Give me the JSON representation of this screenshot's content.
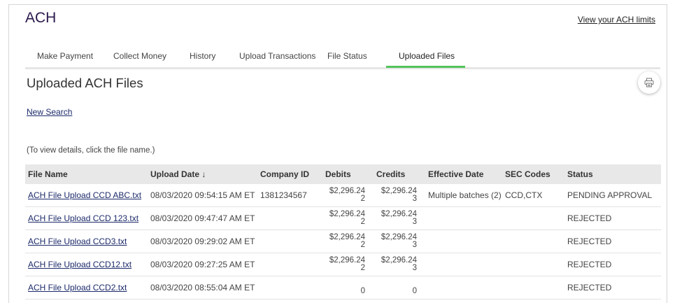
{
  "header": {
    "title": "ACH",
    "limits_link": "View your ACH limits"
  },
  "tabs": [
    {
      "label": "Make Payment"
    },
    {
      "label": "Collect Money"
    },
    {
      "label": "History"
    },
    {
      "label": "Upload Transactions"
    },
    {
      "label": "File Status"
    },
    {
      "label": "Uploaded Files",
      "active": true
    }
  ],
  "page": {
    "title": "Uploaded ACH Files",
    "new_search": "New Search",
    "hint": "(To view details, click the file name.)",
    "print_icon": "printer-icon"
  },
  "table": {
    "headers": [
      "File Name",
      "Upload Date ↓",
      "Company ID",
      "Debits",
      "Credits",
      "Effective Date",
      "SEC Codes",
      "Status"
    ],
    "rows": [
      {
        "file": "ACH File Upload CCD ABC.txt",
        "date": "08/03/2020 09:54:15 AM ET",
        "company": "1381234567",
        "debit_main": "$2,296.24",
        "debit_sub": "2",
        "credit_main": "$2,296.24",
        "credit_sub": "3",
        "effective": "Multiple batches (2)",
        "sec": "CCD,CTX",
        "status": "PENDING APPROVAL"
      },
      {
        "file": "ACH File Upload CCD 123.txt",
        "date": "08/03/2020 09:47:47 AM ET",
        "company": "",
        "debit_main": "$2,296.24",
        "debit_sub": "2",
        "credit_main": "$2,296.24",
        "credit_sub": "3",
        "effective": "",
        "sec": "",
        "status": "REJECTED"
      },
      {
        "file": "ACH File Upload CCD3.txt",
        "date": "08/03/2020 09:29:02 AM ET",
        "company": "",
        "debit_main": "$2,296.24",
        "debit_sub": "2",
        "credit_main": "$2,296.24",
        "credit_sub": "3",
        "effective": "",
        "sec": "",
        "status": "REJECTED"
      },
      {
        "file": "ACH File Upload CCD12.txt",
        "date": "08/03/2020 09:27:25 AM ET",
        "company": "",
        "debit_main": "$2,296.24",
        "debit_sub": "2",
        "credit_main": "$2,296.24",
        "credit_sub": "3",
        "effective": "",
        "sec": "",
        "status": "REJECTED"
      },
      {
        "file": "ACH File Upload CCD2.txt",
        "date": "08/03/2020 08:55:04 AM ET",
        "company": "",
        "debit_main": "",
        "debit_sub": "0",
        "credit_main": "",
        "credit_sub": "0",
        "effective": "",
        "sec": "",
        "status": "REJECTED"
      }
    ]
  }
}
